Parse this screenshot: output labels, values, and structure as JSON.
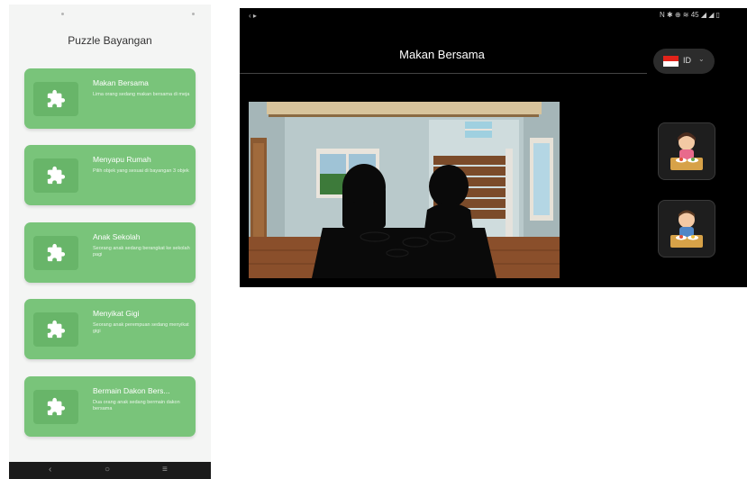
{
  "phone": {
    "title": "Puzzle Bayangan",
    "cards": [
      {
        "title": "Makan Bersama",
        "desc": "Lima orang sedang makan bersama di meja"
      },
      {
        "title": "Menyapu Rumah",
        "desc": "Pilih objek yang sesuai di bayangan 3 objek"
      },
      {
        "title": "Anak Sekolah",
        "desc": "Seorang anak sedang berangkat ke sekolah pagi"
      },
      {
        "title": "Menyikat Gigi",
        "desc": "Seorang anak perempuan sedang menyikat gigi"
      },
      {
        "title": "Bermain Dakon Bers...",
        "desc": "Dua orang anak sedang bermain dakon bersama"
      }
    ],
    "nav": {
      "back": "‹",
      "home": "○",
      "menu": "≡"
    }
  },
  "tablet": {
    "status_left": "‹ ▸",
    "status_right": "N ✱ ⊕ ≋ 45 ◢ ◢ ▯",
    "title": "Makan Bersama",
    "language": {
      "code": "ID",
      "chevron": "⌄",
      "flag_colors": [
        "#e2231a",
        "#ffffff"
      ]
    }
  },
  "colors": {
    "card_green": "#79c47a",
    "card_icon_bg": "#68b569",
    "tablet_bg": "#000000"
  },
  "icons": [
    "puzzle-icon",
    "flag-indonesia-icon",
    "girl-eating-icon",
    "boy-eating-icon"
  ]
}
